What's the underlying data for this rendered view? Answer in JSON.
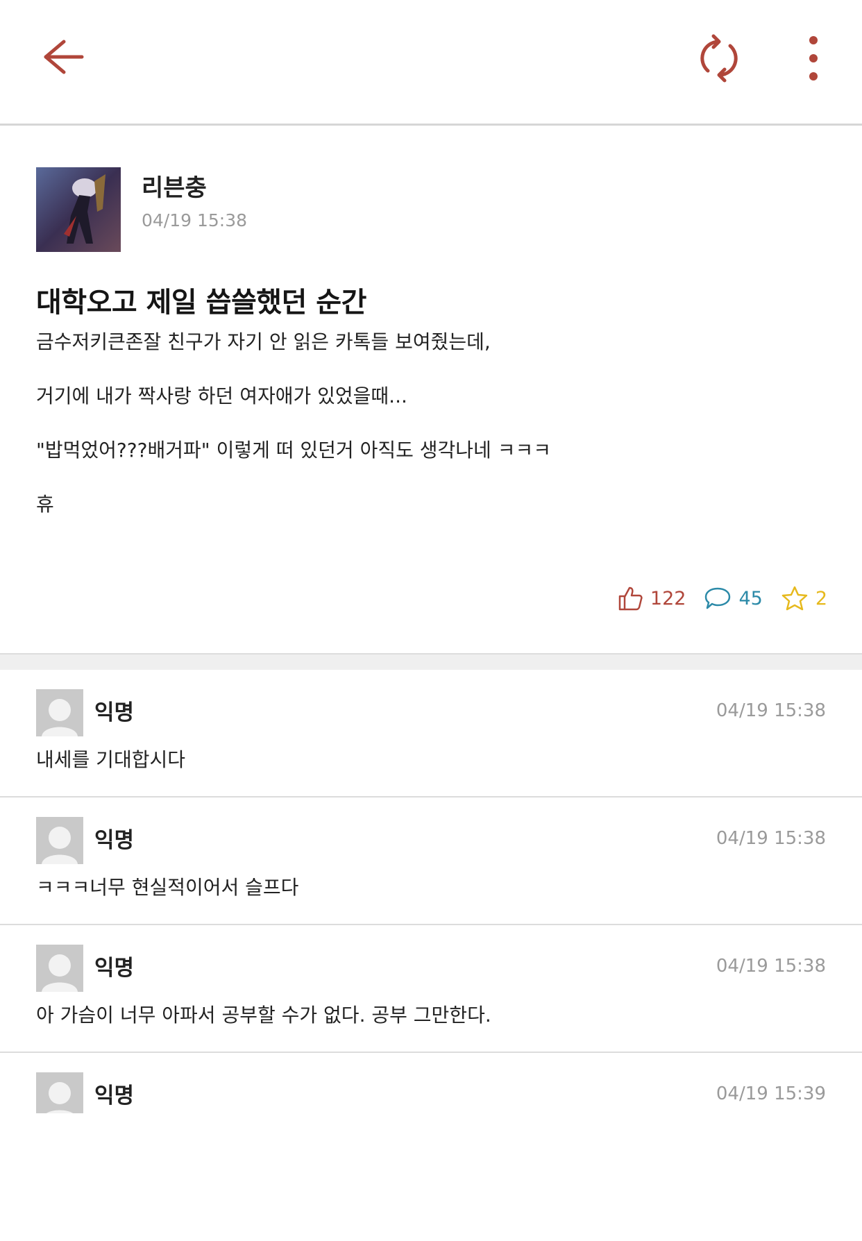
{
  "toolbar": {
    "back_icon": "arrow-left-icon",
    "refresh_icon": "refresh-icon",
    "more_icon": "more-vertical-icon",
    "accent_color": "#b0463a"
  },
  "post": {
    "author": "리븐충",
    "time": "04/19 15:38",
    "title": "대학오고 제일 씁쓸했던 순간",
    "lines": [
      "금수저키큰존잘 친구가 자기 안 읽은 카톡들 보여줬는데,",
      "거기에 내가 짝사랑 하던 여자애가 있었을때...",
      "\"밥먹었어???배거파\" 이렇게 떠 있던거 아직도 생각나네 ㅋㅋㅋ",
      "휴"
    ],
    "stats": {
      "likes": "122",
      "comments": "45",
      "scraps": "2",
      "like_color": "#b0463a",
      "comment_color": "#2c8aa8",
      "scrap_color": "#e6b91c"
    }
  },
  "comments": [
    {
      "name": "익명",
      "time": "04/19 15:38",
      "text": "내세를 기대합시다"
    },
    {
      "name": "익명",
      "time": "04/19 15:38",
      "text": "ㅋㅋㅋ너무 현실적이어서 슬프다"
    },
    {
      "name": "익명",
      "time": "04/19 15:38",
      "text": "아 가슴이 너무 아파서 공부할 수가 없다. 공부 그만한다."
    },
    {
      "name": "익명",
      "time": "04/19 15:39",
      "text": ""
    }
  ]
}
